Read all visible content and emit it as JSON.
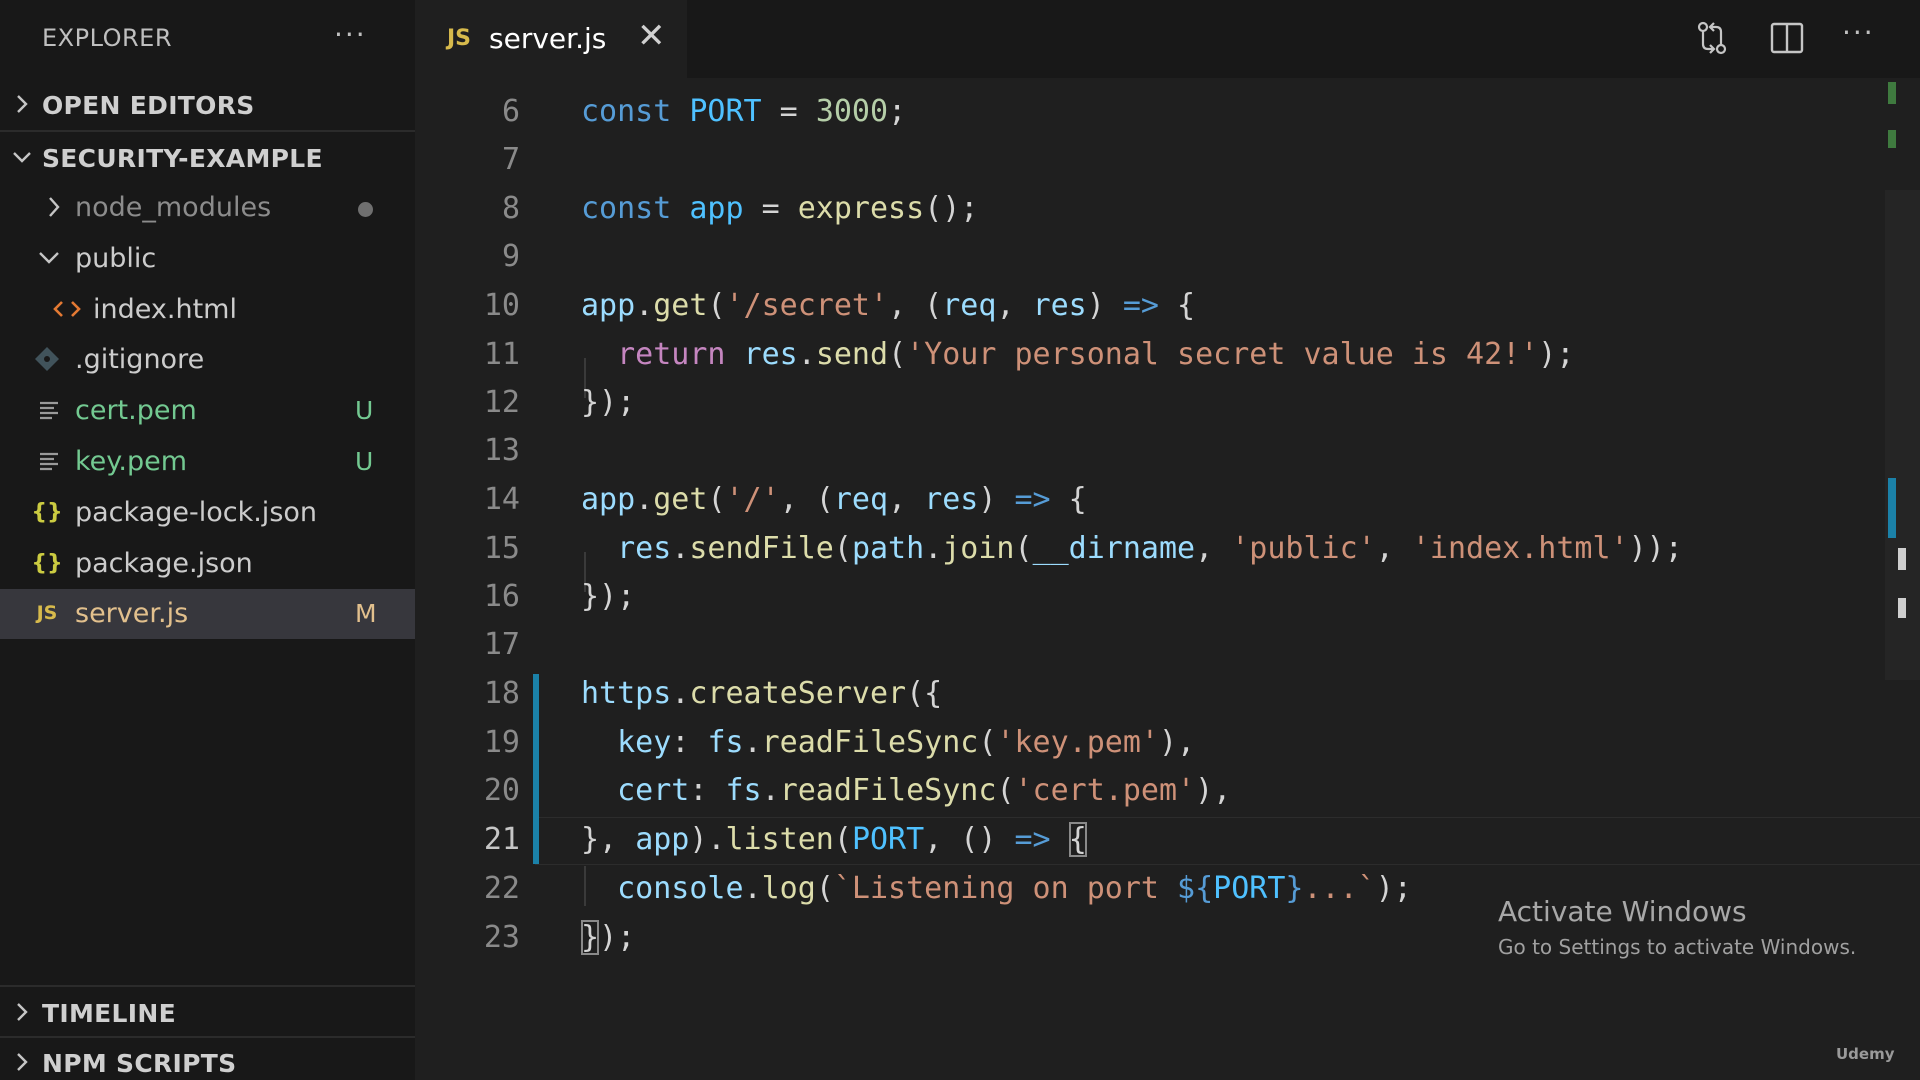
{
  "sidebar": {
    "title": "EXPLORER",
    "sections": {
      "open_editors": "OPEN EDITORS",
      "project": "SECURITY-EXAMPLE",
      "timeline": "TIMELINE",
      "npm_scripts": "NPM SCRIPTS"
    },
    "files": [
      {
        "label": "node_modules",
        "badge": ""
      },
      {
        "label": "public",
        "badge": ""
      },
      {
        "label": "index.html",
        "badge": ""
      },
      {
        "label": ".gitignore",
        "badge": ""
      },
      {
        "label": "cert.pem",
        "badge": "U"
      },
      {
        "label": "key.pem",
        "badge": "U"
      },
      {
        "label": "package-lock.json",
        "badge": ""
      },
      {
        "label": "package.json",
        "badge": ""
      },
      {
        "label": "server.js",
        "badge": "M"
      }
    ],
    "icons": {
      "json": "{}",
      "js": "JS"
    }
  },
  "tab": {
    "lang": "JS",
    "name": "server.js",
    "close": "✕"
  },
  "editor": {
    "line_numbers": [
      "6",
      "7",
      "8",
      "9",
      "10",
      "11",
      "12",
      "13",
      "14",
      "15",
      "16",
      "17",
      "18",
      "19",
      "20",
      "21",
      "22",
      "23"
    ],
    "code": {
      "l6": [
        "const",
        " ",
        "PORT",
        " = ",
        "3000",
        ";"
      ],
      "l8": [
        "const",
        " ",
        "app",
        " = ",
        "express",
        "();"
      ],
      "l10": [
        "app",
        ".",
        "get",
        "(",
        "'/secret'",
        ", (",
        "req",
        ", ",
        "res",
        ") ",
        "=>",
        " {"
      ],
      "l11": [
        "  ",
        "return",
        " ",
        "res",
        ".",
        "send",
        "(",
        "'Your personal secret value is 42!'",
        ");"
      ],
      "l12": [
        "});"
      ],
      "l14": [
        "app",
        ".",
        "get",
        "(",
        "'/'",
        ", (",
        "req",
        ", ",
        "res",
        ") ",
        "=>",
        " {"
      ],
      "l15": [
        "  ",
        "res",
        ".",
        "sendFile",
        "(",
        "path",
        ".",
        "join",
        "(",
        "__dirname",
        ", ",
        "'public'",
        ", ",
        "'index.html'",
        "));"
      ],
      "l16": [
        "});"
      ],
      "l18": [
        "https",
        ".",
        "createServer",
        "({"
      ],
      "l19": [
        "  ",
        "key",
        ": ",
        "fs",
        ".",
        "readFileSync",
        "(",
        "'key.pem'",
        "),"
      ],
      "l20": [
        "  ",
        "cert",
        ": ",
        "fs",
        ".",
        "readFileSync",
        "(",
        "'cert.pem'",
        "),"
      ],
      "l21": [
        "}, ",
        "app",
        ").",
        "listen",
        "(",
        "PORT",
        ", () ",
        "=>",
        " ",
        "{"
      ],
      "l22": [
        "  ",
        "console",
        ".",
        "log",
        "(",
        "`Listening on port ",
        "${",
        "PORT",
        "}",
        "...`",
        ");"
      ],
      "l23": [
        "}",
        ");"
      ]
    }
  },
  "watermark": {
    "title": "Activate Windows",
    "subtitle": "Go to Settings to activate Windows.",
    "brand": "Udemy"
  },
  "colors": {
    "accent_blue": "#1b81a8",
    "untracked_green": "#73c991",
    "modified_yellow": "#e2c08d",
    "js_yellow": "#d7ba4c"
  }
}
